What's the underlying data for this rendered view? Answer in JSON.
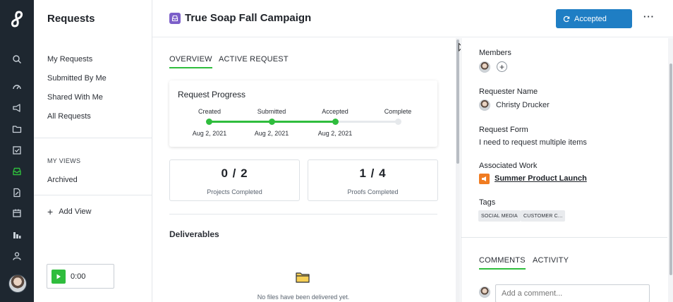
{
  "rail": {
    "icons": [
      "search-icon",
      "dashboard-icon",
      "megaphone-icon",
      "folder-icon",
      "checkbox-icon",
      "inbox-icon",
      "document-edit-icon",
      "calendar-icon",
      "bar-chart-icon",
      "person-icon"
    ],
    "active_icon": "inbox-icon",
    "active_color": "#2fbd3d",
    "background": "#1e2730"
  },
  "sidebar": {
    "title": "Requests",
    "items": [
      {
        "label": "My Requests"
      },
      {
        "label": "Submitted By Me"
      },
      {
        "label": "Shared With Me"
      },
      {
        "label": "All Requests"
      }
    ],
    "views_heading": "MY VIEWS",
    "views": [
      {
        "label": "Archived"
      }
    ],
    "add_view_label": "Add View",
    "timer": "0:00"
  },
  "header": {
    "title": "True Soap Fall Campaign",
    "status_button": "Accepted",
    "more_label": "···",
    "accent": "#1f7ec4"
  },
  "main": {
    "tabs": [
      {
        "label": "OVERVIEW",
        "active": true
      },
      {
        "label": "ACTIVE REQUEST",
        "active": false
      }
    ],
    "progress": {
      "title": "Request Progress",
      "stages": [
        {
          "label": "Created",
          "date": "Aug 2, 2021",
          "done": true
        },
        {
          "label": "Submitted",
          "date": "Aug 2, 2021",
          "done": true
        },
        {
          "label": "Accepted",
          "date": "Aug 2, 2021",
          "done": true
        },
        {
          "label": "Complete",
          "date": "",
          "done": false
        }
      ],
      "done_color": "#2fbd3d"
    },
    "stats": [
      {
        "value": "0 / 2",
        "label": "Projects Completed"
      },
      {
        "value": "1 / 4",
        "label": "Proofs Completed"
      }
    ],
    "deliverables_title": "Deliverables",
    "deliverables_empty": "No files have been delivered yet."
  },
  "details": {
    "members_label": "Members",
    "requester_label": "Requester Name",
    "requester_name": "Christy Drucker",
    "form_label": "Request Form",
    "form_value": "I need to request multiple items",
    "work_label": "Associated Work",
    "work_value": "Summer Product Launch",
    "tags_label": "Tags",
    "tags": [
      "SOCIAL MEDIA",
      "CUSTOMER C..."
    ],
    "tabs": [
      {
        "label": "COMMENTS",
        "active": true
      },
      {
        "label": "ACTIVITY",
        "active": false
      }
    ],
    "comment_placeholder": "Add a comment..."
  }
}
